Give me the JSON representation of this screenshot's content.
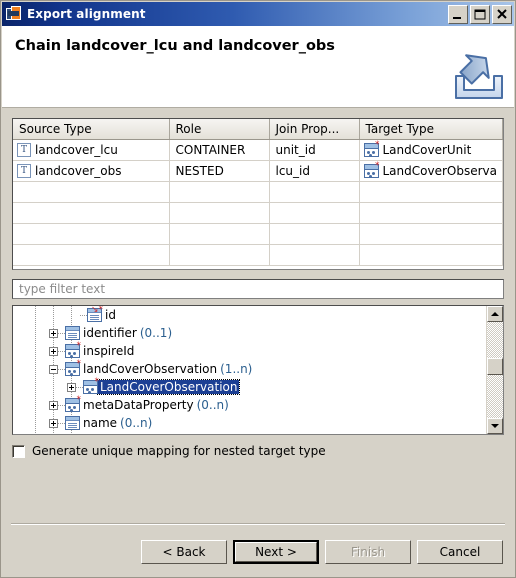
{
  "window": {
    "title": "Export alignment",
    "icon": "export-alignment-icon",
    "controls": {
      "minimize": "minimize-icon",
      "maximize": "maximize-icon",
      "close": "close-icon"
    }
  },
  "header": {
    "title": "Chain landcover_lcu and landcover_obs",
    "icon": "export-wizard-icon"
  },
  "table": {
    "columns": [
      "Source Type",
      "Role",
      "Join Prop...",
      "Target Type"
    ],
    "rows": [
      {
        "source_type": "landcover_lcu",
        "source_icon": "table-type-icon",
        "role": "CONTAINER",
        "join_property": "unit_id",
        "target_type": "LandCoverUnit",
        "target_icon": "complex-type-icon"
      },
      {
        "source_type": "landcover_obs",
        "source_icon": "table-type-icon",
        "role": "NESTED",
        "join_property": "lcu_id",
        "target_type": "LandCoverObserva",
        "target_icon": "complex-type-icon"
      }
    ],
    "empty_row_count": 4
  },
  "filter": {
    "placeholder": "type filter text",
    "value": ""
  },
  "tree": {
    "items": [
      {
        "label": "id",
        "cardinality": "",
        "indent": 3,
        "twisty": "none",
        "icon": "attribute-icon",
        "selected": false
      },
      {
        "label": "identifier",
        "cardinality": "(0..1)",
        "indent": 2,
        "twisty": "plus",
        "icon": "element-icon",
        "selected": false
      },
      {
        "label": "inspireId",
        "cardinality": "",
        "indent": 2,
        "twisty": "plus",
        "icon": "complex-type-icon",
        "selected": false
      },
      {
        "label": "landCoverObservation",
        "cardinality": "(1..n)",
        "indent": 2,
        "twisty": "minus",
        "icon": "complex-type-icon",
        "selected": false
      },
      {
        "label": "LandCoverObservation",
        "cardinality": "",
        "indent": 3,
        "twisty": "plus",
        "icon": "complex-type-icon",
        "selected": true
      },
      {
        "label": "metaDataProperty",
        "cardinality": "(0..n)",
        "indent": 2,
        "twisty": "plus",
        "icon": "complex-type-icon",
        "selected": false
      },
      {
        "label": "name",
        "cardinality": "(0..n)",
        "indent": 2,
        "twisty": "plus",
        "icon": "element-icon",
        "selected": false
      }
    ],
    "scrollbar": {
      "up_arrow": "scroll-up-icon",
      "down_arrow": "scroll-down-icon",
      "thumb_position_percent": 38
    }
  },
  "options": {
    "generate_unique_mapping_label": "Generate unique mapping for nested target type",
    "generate_unique_mapping_checked": false
  },
  "footer": {
    "back": "< Back",
    "next": "Next >",
    "finish": "Finish",
    "cancel": "Cancel",
    "default_button": "Next >",
    "disabled_button": "Finish"
  },
  "colors": {
    "titlebar_start": "#0a246a",
    "titlebar_end": "#a8c4e8",
    "dialog_bg": "#d6d2c8",
    "selection_bg": "#1c3f94",
    "cardinality_text": "#2b5f8f"
  }
}
